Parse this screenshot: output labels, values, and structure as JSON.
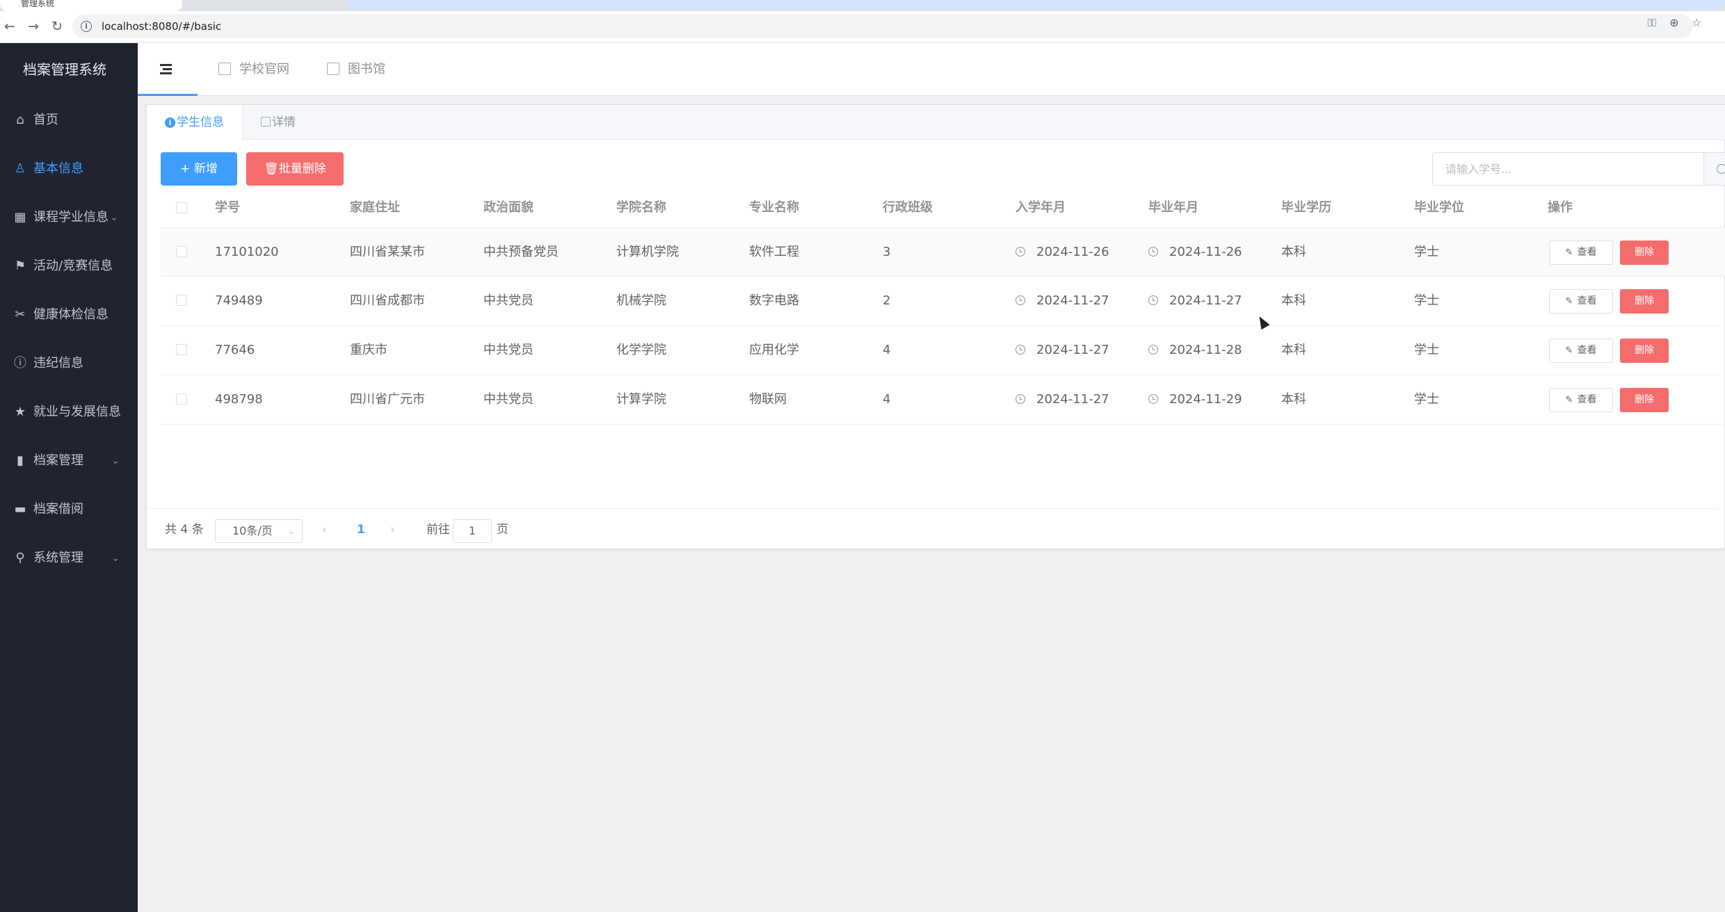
{
  "browser": {
    "tab_title": "管理系统",
    "url": "localhost:8080/#/basic"
  },
  "sidebar": {
    "title": "档案管理系统",
    "items": [
      {
        "label": "首页",
        "icon": "home-icon"
      },
      {
        "label": "基本信息",
        "icon": "user-icon",
        "active": true
      },
      {
        "label": "课程学业信息",
        "icon": "grid-icon",
        "has_children": true
      },
      {
        "label": "活动/竞赛信息",
        "icon": "flag-icon"
      },
      {
        "label": "健康体检信息",
        "icon": "scissors-icon"
      },
      {
        "label": "违纪信息",
        "icon": "info-icon"
      },
      {
        "label": "就业与发展信息",
        "icon": "star-icon"
      },
      {
        "label": "档案管理",
        "icon": "chart-icon",
        "has_children": true
      },
      {
        "label": "档案借阅",
        "icon": "wallet-icon"
      },
      {
        "label": "系统管理",
        "icon": "location-icon",
        "has_children": true
      }
    ]
  },
  "header": {
    "links": [
      {
        "label": "学校官网",
        "icon": "building-icon"
      },
      {
        "label": "图书馆",
        "icon": "copy-icon"
      }
    ]
  },
  "card": {
    "tabs": [
      {
        "label": "学生信息",
        "active": true
      },
      {
        "label": "详情"
      }
    ],
    "add_label": "+ 新增",
    "batch_delete_label": "批量删除",
    "search_placeholder": "请输入学号..."
  },
  "table": {
    "columns": [
      "学号",
      "家庭住址",
      "政治面貌",
      "学院名称",
      "专业名称",
      "行政班级",
      "入学年月",
      "毕业年月",
      "毕业学历",
      "毕业学位",
      "操作"
    ],
    "view_label": "查看",
    "delete_label": "删除",
    "rows": [
      [
        "17101020",
        "四川省某某市",
        "中共预备党员",
        "计算机学院",
        "软件工程",
        "3",
        "2024-11-26",
        "2024-11-26",
        "本科",
        "学士"
      ],
      [
        "749489",
        "四川省成都市",
        "中共党员",
        "机械学院",
        "数字电路",
        "2",
        "2024-11-27",
        "2024-11-27",
        "本科",
        "学士"
      ],
      [
        "77646",
        "重庆市",
        "中共党员",
        "化学学院",
        "应用化学",
        "4",
        "2024-11-27",
        "2024-11-28",
        "本科",
        "学士"
      ],
      [
        "498798",
        "四川省广元市",
        "中共党员",
        "计算学院",
        "物联网",
        "4",
        "2024-11-27",
        "2024-11-29",
        "本科",
        "学士"
      ]
    ]
  },
  "pagination": {
    "total_text": "共 4 条",
    "page_size": "10条/页",
    "current_page": "1",
    "goto_prefix": "前往",
    "goto_value": "1",
    "goto_suffix": "页"
  },
  "colors": {
    "primary": "#409eff",
    "danger": "#f56c6c",
    "sidebar_bg": "#1f2430"
  }
}
